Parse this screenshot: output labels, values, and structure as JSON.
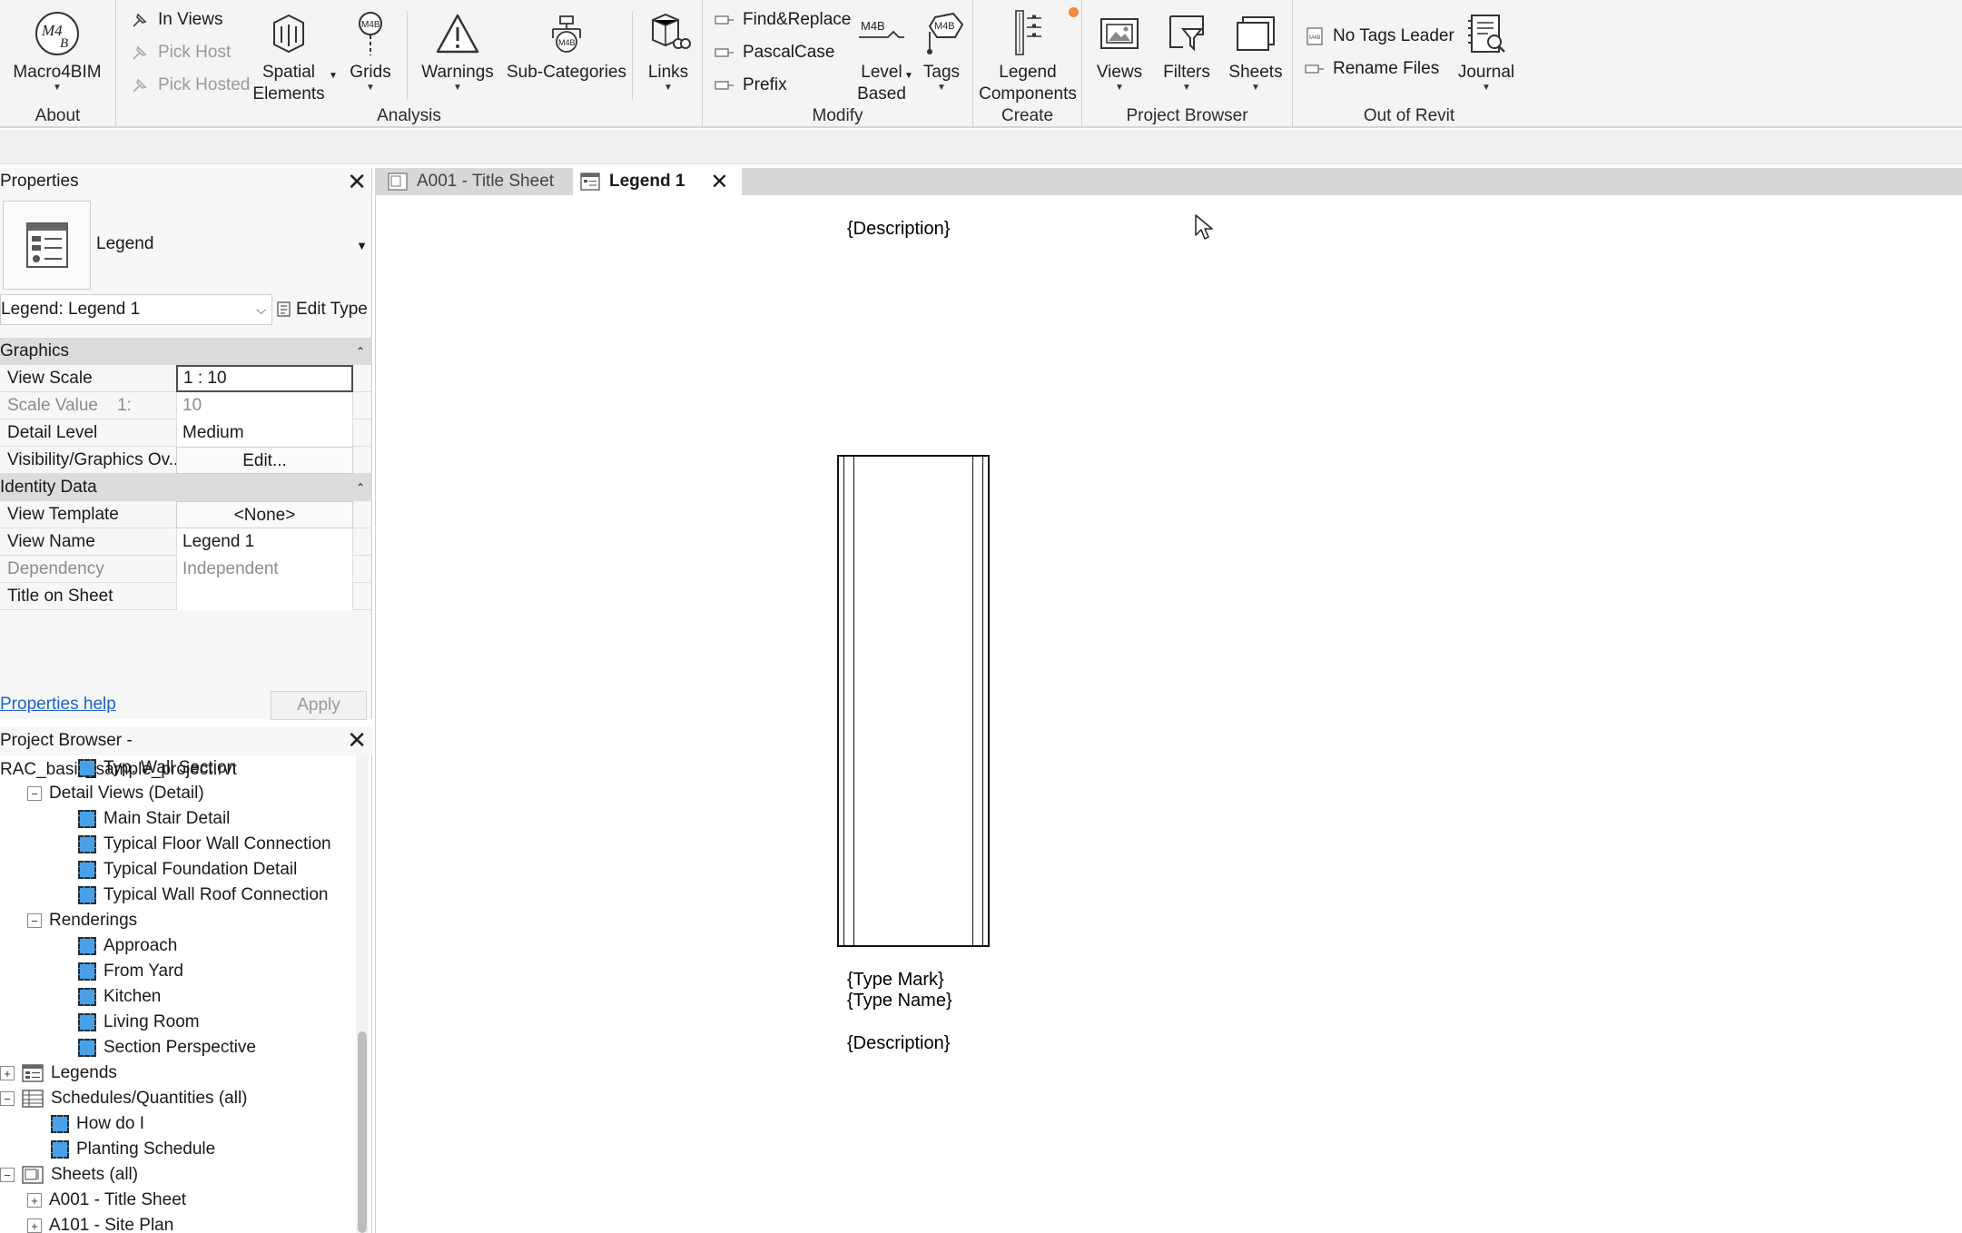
{
  "ribbon": {
    "about": {
      "title": "About",
      "macro_label": "Macro4BIM"
    },
    "analysis": {
      "title": "Analysis",
      "in_views": "In Views",
      "pick_host": "Pick Host",
      "pick_hosted": "Pick Hosted",
      "spatial_line1": "Spatial",
      "spatial_line2": "Elements",
      "grids": "Grids",
      "warnings": "Warnings",
      "subcats": "Sub-Categories",
      "links": "Links"
    },
    "modify": {
      "title": "Modify",
      "find_replace": "Find&Replace",
      "pascal_case": "PascalCase",
      "prefix": "Prefix",
      "level_line1": "Level",
      "level_line2": "Based",
      "tags": "Tags",
      "m4b_badge": "M4B"
    },
    "create": {
      "title": "Create",
      "legend_line1": "Legend",
      "legend_line2": "Components"
    },
    "project_browser": {
      "title": "Project Browser",
      "views": "Views",
      "filters": "Filters",
      "sheets": "Sheets"
    },
    "out_of_revit": {
      "title": "Out of Revit",
      "no_tags_leader": "No Tags Leader",
      "rename_files": "Rename Files",
      "journal": "Journal"
    }
  },
  "properties": {
    "header": "Properties",
    "type_name": "Legend",
    "instance_selector": "Legend: Legend 1",
    "edit_type": "Edit Type",
    "groups": {
      "graphics": "Graphics",
      "identity": "Identity Data"
    },
    "rows": {
      "view_scale": {
        "k": "View Scale",
        "v": "1 : 10"
      },
      "scale_value": {
        "k": "Scale Value    1:",
        "v": "10"
      },
      "detail_level": {
        "k": "Detail Level",
        "v": "Medium"
      },
      "vis_graphics": {
        "k": "Visibility/Graphics Ov...",
        "v": "Edit..."
      },
      "view_template": {
        "k": "View Template",
        "v": "<None>"
      },
      "view_name": {
        "k": "View Name",
        "v": "Legend 1"
      },
      "dependency": {
        "k": "Dependency",
        "v": "Independent"
      },
      "title_on_sheet": {
        "k": "Title on Sheet",
        "v": ""
      }
    },
    "help": "Properties help",
    "apply": "Apply"
  },
  "project_browser": {
    "header": "Project Browser - RAC_basic_sample_project.rvt",
    "nodes": {
      "typ_wall_section": "Typ. Wall Section",
      "detail_views": "Detail Views (Detail)",
      "main_stair": "Main Stair Detail",
      "floor_wall": "Typical Floor Wall Connection",
      "foundation": "Typical Foundation Detail",
      "wall_roof": "Typical Wall Roof Connection",
      "renderings": "Renderings",
      "approach": "Approach",
      "from_yard": "From Yard",
      "kitchen": "Kitchen",
      "living_room": "Living Room",
      "section_persp": "Section Perspective",
      "legends": "Legends",
      "schedules": "Schedules/Quantities (all)",
      "how_do_i": "How do I",
      "planting": "Planting Schedule",
      "sheets": "Sheets (all)",
      "a001": "A001 - Title Sheet",
      "a101": "A101 - Site Plan"
    }
  },
  "tabs": {
    "tab1": "A001 - Title Sheet",
    "tab2": "Legend 1"
  },
  "canvas": {
    "desc_top": "{Description}",
    "type_mark": "{Type Mark}",
    "type_name": "{Type Name}",
    "desc_bottom": "{Description}"
  },
  "colors": {
    "accent_dot": "#f08a3c",
    "view_icon": "#4aa0e6",
    "link": "#1a64c8"
  }
}
